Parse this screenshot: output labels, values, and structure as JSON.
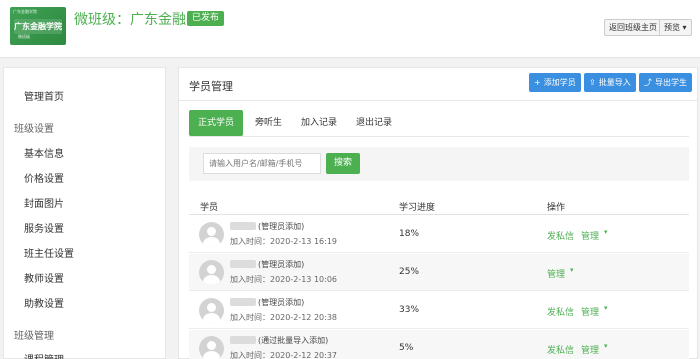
{
  "header": {
    "cover": {
      "top": "广东金融学院",
      "title": "广东金融学院",
      "sub": "微班级"
    },
    "title": "微班级：广东金融学院",
    "status": "已发布",
    "back_label": "返回班级主页",
    "preview_label": "预览"
  },
  "sidebar": {
    "items": [
      {
        "label": "管理首页"
      },
      {
        "label": "班级设置",
        "group": true
      },
      {
        "label": "基本信息"
      },
      {
        "label": "价格设置"
      },
      {
        "label": "封面图片"
      },
      {
        "label": "服务设置"
      },
      {
        "label": "班主任设置"
      },
      {
        "label": "教师设置"
      },
      {
        "label": "助教设置"
      },
      {
        "label": "班级管理",
        "group": true
      },
      {
        "label": "课程管理"
      }
    ]
  },
  "main": {
    "title": "学员管理",
    "buttons": {
      "add": "添加学员",
      "import": "批量导入",
      "export": "导出学生"
    },
    "tabs": [
      "正式学员",
      "旁听生",
      "加入记录",
      "退出记录"
    ],
    "search": {
      "placeholder": "请输入用户名/邮箱/手机号",
      "button": "搜索"
    },
    "columns": [
      "学员",
      "学习进度",
      "操作"
    ],
    "rows": [
      {
        "source": "(管理员添加)",
        "joined": "加入时间：2020-2-13 16:19",
        "progress": "18%",
        "msg": "发私信",
        "manage": "管理"
      },
      {
        "source": "(管理员添加)",
        "joined": "加入时间：2020-2-13 10:06",
        "progress": "25%",
        "msg": "",
        "manage": "管理"
      },
      {
        "source": "(管理员添加)",
        "joined": "加入时间：2020-2-12 20:38",
        "progress": "33%",
        "msg": "发私信",
        "manage": "管理"
      },
      {
        "source": "(通过批量导入添加)",
        "joined": "加入时间：2020-2-12 20:37",
        "progress": "5%",
        "msg": "发私信",
        "manage": "管理"
      }
    ]
  },
  "colors": {
    "accent": "#4caf50",
    "blue": "#3b8fe0"
  },
  "icons": {
    "add": "plus-icon",
    "import": "upload-icon",
    "export": "export-icon",
    "caret": "caret-down-icon"
  }
}
